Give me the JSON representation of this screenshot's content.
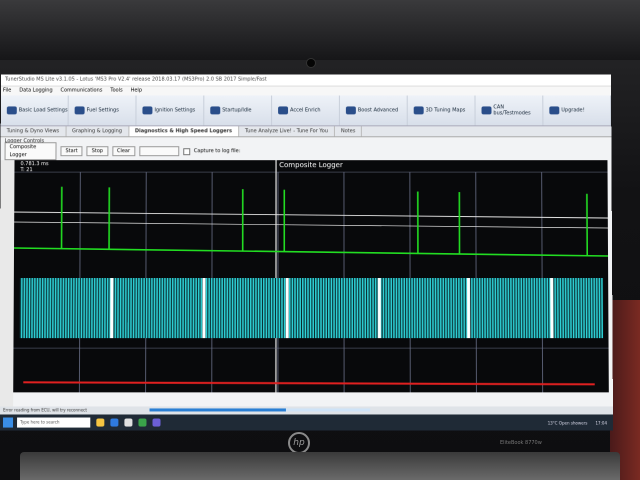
{
  "window": {
    "title": "TunerStudio MS Lite v3.1.05 - Lotus 'MS3 Pro V2.4' release 2018.03.17 (MS3Pro) 2.0 SB 2017 Simple/Fast"
  },
  "menubar": {
    "items": [
      "File",
      "Data Logging",
      "Communications",
      "Tools",
      "Help"
    ]
  },
  "toolbar": {
    "items": [
      {
        "label": "Basic Load Settings",
        "icon": "settings-icon"
      },
      {
        "label": "Fuel Settings",
        "icon": "fuel-icon"
      },
      {
        "label": "Ignition Settings",
        "icon": "ignition-icon"
      },
      {
        "label": "Startup/Idle",
        "icon": "idle-icon"
      },
      {
        "label": "Accel Enrich",
        "icon": "accel-icon"
      },
      {
        "label": "Boost Advanced",
        "icon": "boost-icon"
      },
      {
        "label": "3D Tuning Maps",
        "icon": "maps-icon"
      },
      {
        "label": "CAN bus/Testmodes",
        "icon": "can-icon"
      },
      {
        "label": "Upgrade!",
        "icon": "upgrade-icon"
      }
    ]
  },
  "tabs": [
    {
      "label": "Tuning & Dyno Views",
      "active": false
    },
    {
      "label": "Graphing & Logging",
      "active": false
    },
    {
      "label": "Diagnostics & High Speed Loggers",
      "active": true
    },
    {
      "label": "Tune Analyze Live! - Tune For You",
      "active": false
    },
    {
      "label": "Notes",
      "active": false
    }
  ],
  "logger": {
    "section_label": "Logger Controls",
    "type_value": "Composite Logger",
    "start_label": "Start",
    "stop_label": "Stop",
    "clear_label": "Clear",
    "capture_label": "Capture to log file:"
  },
  "chart_data": {
    "type": "line",
    "title": "Composite Logger",
    "readout": [
      "0.781.3 ms",
      "T: 21"
    ],
    "series": [
      {
        "color": "#22dd22",
        "trigger_x": [
          0.08,
          0.16,
          0.385,
          0.455,
          0.68,
          0.75,
          0.965
        ]
      },
      {
        "color": "#2ed3d8",
        "gap_x": [
          0.165,
          0.32,
          0.46,
          0.615,
          0.765,
          0.905
        ]
      },
      {
        "color": "#e02020"
      }
    ],
    "colors": {
      "background": "#08090b",
      "grid": "#6a7088",
      "white_trace": "#e8e8e8"
    }
  },
  "status": {
    "text": "Error reading from ECU, will try reconnect",
    "progress": 0.62
  },
  "taskbar": {
    "search_placeholder": "Type here to search",
    "weather": "13°C Open showers",
    "clock": "17:04"
  },
  "laptop": {
    "brand": "hp",
    "model": "EliteBook 8770w"
  }
}
